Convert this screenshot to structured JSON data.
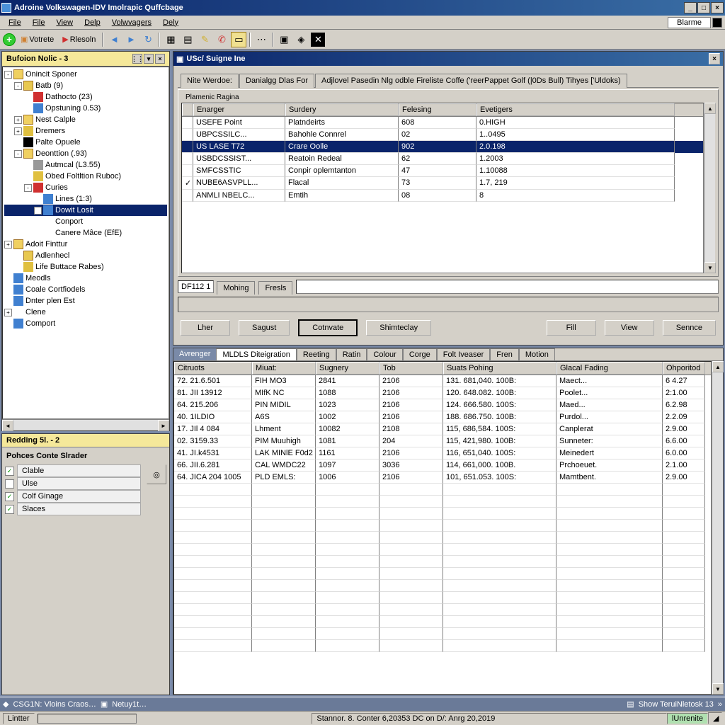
{
  "title": "Adroine Volkswagen-IDV Imolrapic Quffcbage",
  "menu": [
    "File",
    "File",
    "View",
    "Delp",
    "Volwvagers",
    "Dely"
  ],
  "edge_label": "Blarme",
  "toolbar": {
    "votrete": "Votrete",
    "nesoln": "Rlesoln"
  },
  "left_panel": {
    "title": "Bufoion Nolic - 3"
  },
  "tree": [
    {
      "d": 0,
      "e": "-",
      "ic": "fo",
      "l": "Onincit Sponer"
    },
    {
      "d": 1,
      "e": "-",
      "ic": "fo2",
      "l": "Batb (9)"
    },
    {
      "d": 2,
      "e": "",
      "ic": "db",
      "l": "Dathocto (23)"
    },
    {
      "d": 2,
      "e": "",
      "ic": "pg",
      "l": "Opstuning 0.53)"
    },
    {
      "d": 1,
      "e": "+",
      "ic": "fo",
      "l": "Nest Calple"
    },
    {
      "d": 1,
      "e": "+",
      "ic": "ic-y",
      "l": "Dremers"
    },
    {
      "d": 1,
      "e": "",
      "ic": "ic-bl",
      "l": "Palte Opuele"
    },
    {
      "d": 1,
      "e": "-",
      "ic": "fo",
      "l": "Deonttion (.93)"
    },
    {
      "d": 2,
      "e": "",
      "ic": "ic-g",
      "l": "Autmcal (L3.55)"
    },
    {
      "d": 2,
      "e": "",
      "ic": "ic-y",
      "l": "Obed Foltltion Ruboc)"
    },
    {
      "d": 2,
      "e": "-",
      "ic": "db",
      "l": "Curies"
    },
    {
      "d": 3,
      "e": "",
      "ic": "pg",
      "l": "Lines (1:3)"
    },
    {
      "d": 3,
      "e": "+",
      "ic": "pg",
      "l": "Dowit Losit",
      "sel": true
    },
    {
      "d": 3,
      "e": "",
      "ic": "",
      "l": "Conport"
    },
    {
      "d": 3,
      "e": "",
      "ic": "",
      "l": "Canere Mâce (EfE)"
    },
    {
      "d": 0,
      "e": "+",
      "ic": "fo",
      "l": "Adoit Finttur"
    },
    {
      "d": 1,
      "e": "",
      "ic": "fo2",
      "l": "Adlenhecl"
    },
    {
      "d": 1,
      "e": "",
      "ic": "ic-y",
      "l": "Life Buttace Rabes)"
    },
    {
      "d": 0,
      "e": "",
      "ic": "pg",
      "l": "Meodls"
    },
    {
      "d": 0,
      "e": "",
      "ic": "pg",
      "l": "Coale Cortfiodels"
    },
    {
      "d": 0,
      "e": "",
      "ic": "pg",
      "l": "Dnter plen Est"
    },
    {
      "d": 0,
      "e": "+",
      "ic": "",
      "l": "Clene"
    },
    {
      "d": 0,
      "e": "",
      "ic": "pg",
      "l": "Comport"
    }
  ],
  "redding": {
    "title": "Redding 5l. - 2",
    "header": "Pohces Conte Slrader",
    "items": [
      {
        "chk": "✓",
        "l": "Clable"
      },
      {
        "chk": "",
        "l": "Ulse"
      },
      {
        "chk": "✓",
        "l": "Colf Ginage"
      },
      {
        "chk": "✓",
        "l": "Slaces"
      }
    ]
  },
  "subwindow": {
    "title": "USc/ Suigne Ine",
    "tabs": [
      "Nite Werdoe:",
      "Danialgg Dlas For",
      "Adjlovel Pasedin Nlg odble Fireliste Coffe ('reerPappet Golf (|0Ds Bull) Tihyes ['Uldoks)"
    ],
    "group_label": "Plamenic Ragina",
    "cols": [
      "",
      "Enarger",
      "Surdery",
      "Felesing",
      "Evetigers"
    ],
    "rows": [
      {
        "c0": "",
        "c1": "USEFE Point",
        "c2": "Platndeirts",
        "c3": "608",
        "c4": "0.HIGH"
      },
      {
        "c0": "",
        "c1": "UBPCSSILC...",
        "c2": "Bahohle Connrel",
        "c3": "02",
        "c4": "1..0495"
      },
      {
        "c0": "",
        "c1": "US LASE T72",
        "c2": "Crare Oolle",
        "c3": "902",
        "c4": "2.0.198",
        "sel": true
      },
      {
        "c0": "",
        "c1": "USBDCSSIST...",
        "c2": "Reatoin Redeal",
        "c3": "62",
        "c4": "1.2003"
      },
      {
        "c0": "",
        "c1": "SMFCSSTIC",
        "c2": "Conpir oplemtanton",
        "c3": "47",
        "c4": "1.10088"
      },
      {
        "c0": "✓",
        "c1": "NUBE6ASVPLL...",
        "c2": "Flacal",
        "c3": "73",
        "c4": "1.7, 219"
      },
      {
        "c0": "",
        "c1": "ANMLI NBELC...",
        "c2": "Emtih",
        "c3": "08",
        "c4": "8"
      }
    ],
    "sub_field": "DF112 1",
    "sub_tabs": [
      "Mohing",
      "Fresls"
    ],
    "buttons": [
      "Lher",
      "Sagust",
      "Cotnvate",
      "Shimteclay",
      "Fill",
      "View",
      "Sennce"
    ]
  },
  "bottom": {
    "lead": "Avrenger",
    "tabs": [
      "MLDLS Diteigration",
      "Reeting",
      "Ratin",
      "Colour",
      "Corge",
      "Folt Iveaser",
      "Fren",
      "Motion"
    ],
    "cols": [
      "Citruots",
      "Miuat:",
      "Sugnery",
      "Tob",
      "Suats Pohing",
      "Glacal Fading",
      "Ohporitod"
    ],
    "rows": [
      [
        "72. 21.6.501",
        "FIH MO3",
        "2841",
        "2106",
        "131. 681,040. 100B:",
        "Maect...",
        "6 4.27"
      ],
      [
        "81. JII 13912",
        "MIfK NC",
        "1088",
        "2106",
        "120. 648.082. 100B:",
        "Poolet...",
        "2:1.00"
      ],
      [
        "64. 215.206",
        "PIN MIDIL",
        "1023",
        "2106",
        "124. 666.580. 100S:",
        "Maed...",
        "6.2.98"
      ],
      [
        "40. 1ILDIO",
        "A6S",
        "1002",
        "2106",
        "188. 686.750. 100B:",
        "Purdol...",
        "2.2.09"
      ],
      [
        "17. JIl 4 084",
        "Lhment",
        "10082",
        "2108",
        "115, 686,584. 100S:",
        "Canplerat",
        "2.9.00"
      ],
      [
        "02. 3159.33",
        "PIM Muuhigh",
        "1081",
        "204",
        "115, 421,980. 100B:",
        "Sunneter:",
        "6.6.00"
      ],
      [
        "41. JI.k4531",
        "LAK MINlE F0d2",
        "1161",
        "2106",
        "116, 651,040. 100S:",
        "Meinedert",
        "6.0.00"
      ],
      [
        "66. JII.6.281",
        "CAL WMDC22",
        "1097",
        "3036",
        "114, 661,000. 100B.",
        "Prchoeuet.",
        "2.1.00"
      ],
      [
        "64. JICA 204 1005",
        "PLD EMLS:",
        "1006",
        "2106",
        "101, 651.053. 100S:",
        "Mamtbent.",
        "2.9.00"
      ]
    ]
  },
  "statusbar1": {
    "l1": "CSG1N: Vloins Craos…",
    "l2": "Netuy1t…",
    "r": "Show TeruiNletosk 13"
  },
  "statusbar2": {
    "l": "Lintter",
    "c": "Stannor. 8. Conter 6,20353 DC on D/:   Anrg 20,2019",
    "r": "lUnrenite"
  }
}
